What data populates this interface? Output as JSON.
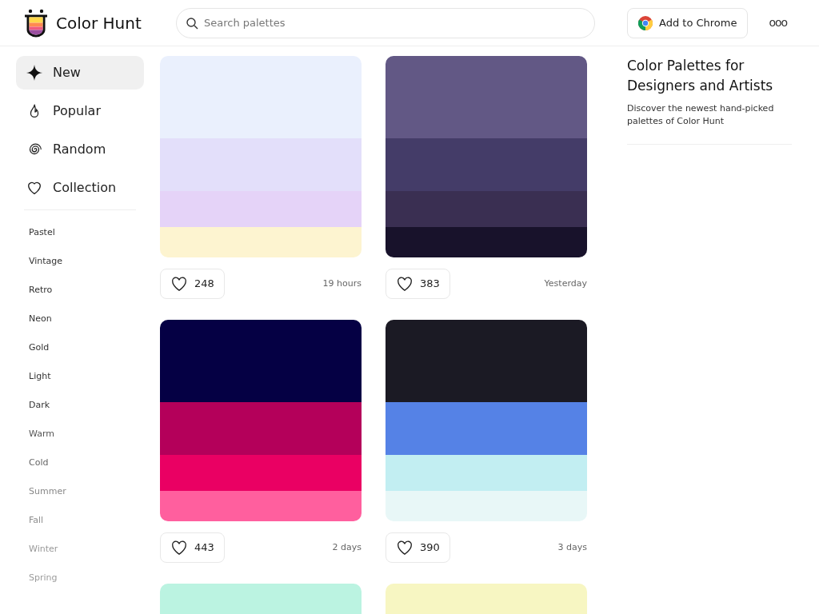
{
  "header": {
    "brand": "Color Hunt",
    "search": {
      "placeholder": "Search palettes"
    },
    "chrome_button": "Add to Chrome",
    "more": "ooo"
  },
  "nav": [
    {
      "label": "New",
      "kind": "sparkle",
      "selected": true
    },
    {
      "label": "Popular",
      "kind": "flame",
      "selected": false
    },
    {
      "label": "Random",
      "kind": "spiral",
      "selected": false
    },
    {
      "label": "Collection",
      "kind": "heart",
      "selected": false
    }
  ],
  "tags": [
    "Pastel",
    "Vintage",
    "Retro",
    "Neon",
    "Gold",
    "Light",
    "Dark",
    "Warm",
    "Cold",
    "Summer",
    "Fall",
    "Winter",
    "Spring"
  ],
  "palettes": [
    {
      "swatches": [
        {
          "color": "#eaf0fd"
        },
        {
          "color": "#e3dffa"
        },
        {
          "color": "#e5d3f8"
        },
        {
          "color": "#fdf4d0"
        }
      ],
      "likes": "248",
      "time": "19 hours"
    },
    {
      "swatches": [
        {
          "color": "#625885"
        },
        {
          "color": "#443c68"
        },
        {
          "color": "#3a2f52"
        },
        {
          "color": "#18122b"
        }
      ],
      "likes": "383",
      "time": "Yesterday"
    },
    {
      "swatches": [
        {
          "color": "#050044"
        },
        {
          "color": "#b4005a"
        },
        {
          "color": "#ea0063"
        },
        {
          "color": "#ff5f9e"
        }
      ],
      "likes": "443",
      "time": "2 days"
    },
    {
      "swatches": [
        {
          "color": "#1b1a24"
        },
        {
          "color": "#5582e6"
        },
        {
          "color": "#c2eef2"
        },
        {
          "color": "#e8f7f7"
        }
      ],
      "likes": "390",
      "time": "3 days"
    },
    {
      "swatches": [
        {
          "color": "#bbf3e1"
        }
      ]
    },
    {
      "swatches": [
        {
          "color": "#f7f6c2"
        }
      ]
    }
  ],
  "aside": {
    "title": "Color Palettes for Designers and Artists",
    "text": "Discover the newest hand-picked palettes of Color Hunt"
  }
}
